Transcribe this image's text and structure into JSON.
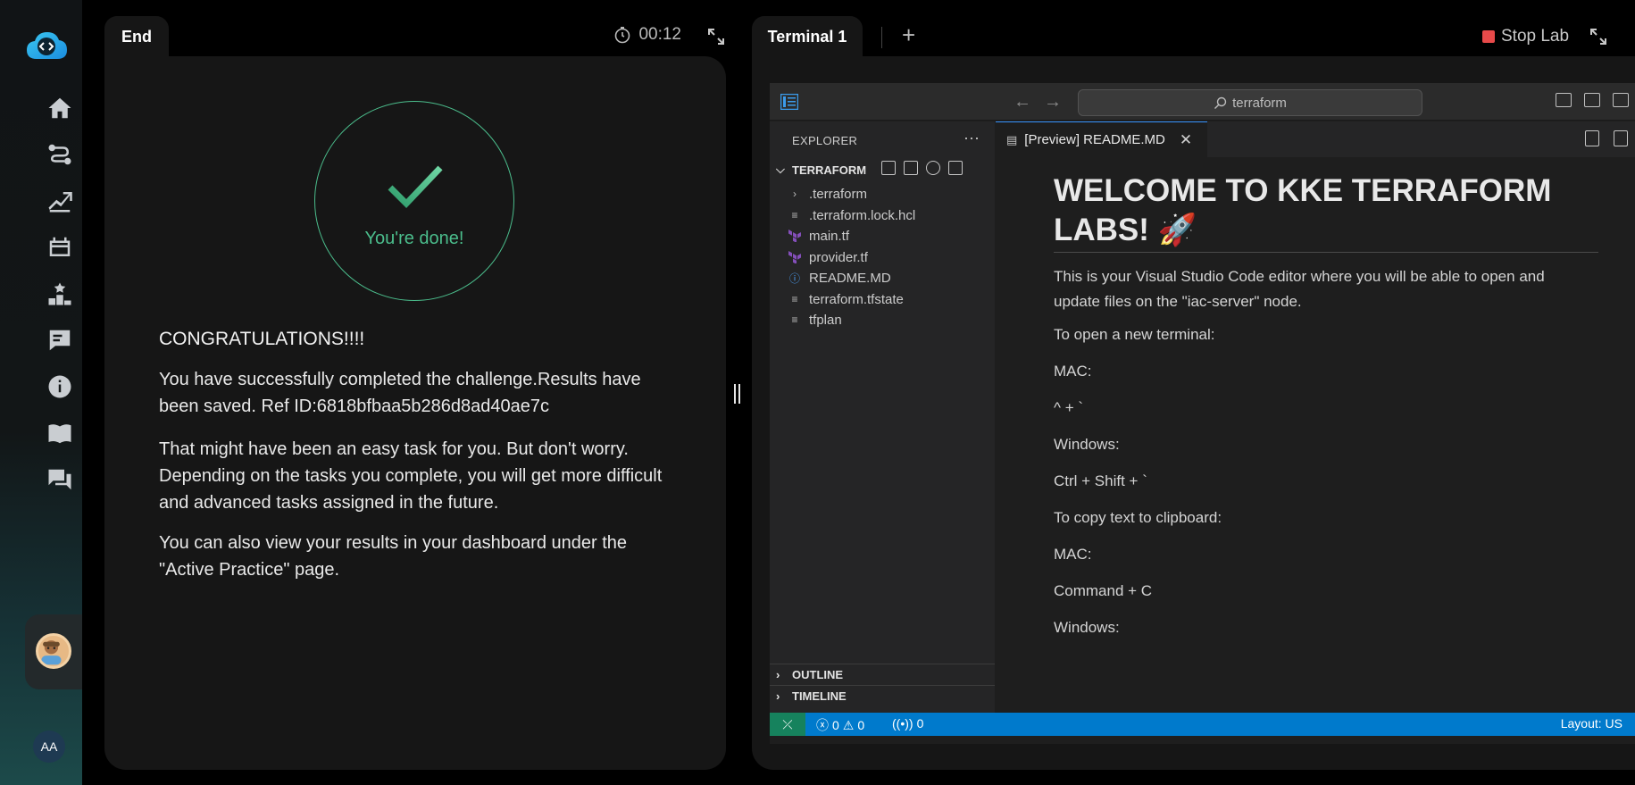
{
  "rail": {
    "nav_icons": [
      "home-icon",
      "roadmap-icon",
      "progress-icon",
      "labs-icon",
      "leaderboard-icon",
      "feedback-icon",
      "info-icon",
      "book-icon",
      "chat-icon"
    ],
    "initials": "AA"
  },
  "end_panel": {
    "tab_label": "End",
    "timer": "00:12",
    "done_text": "You're done!",
    "heading": "CONGRATULATIONS!!!!",
    "para1": "You have successfully completed the challenge.Results have been saved. Ref ID:6818bfbaa5b286d8ad40ae7c",
    "para2": "That might have been an easy task for you. But don't worry. Depending on the tasks you complete, you will get more difficult and advanced tasks assigned in the future.",
    "para3": "You can also view your results in your dashboard under the \"Active Practice\" page."
  },
  "terminal_panel": {
    "tab_label": "Terminal 1",
    "add_label": "+",
    "stop_label": "Stop Lab"
  },
  "vscode": {
    "search_placeholder": "terraform",
    "explorer_title": "EXPLORER",
    "folder": "TERRAFORM",
    "files": [
      ".terraform",
      ".terraform.lock.hcl",
      "main.tf",
      "provider.tf",
      "README.MD",
      "terraform.tfstate",
      "tfplan"
    ],
    "outline": "OUTLINE",
    "timeline": "TIMELINE",
    "tab": "[Preview] README.MD",
    "preview": {
      "h1": "WELCOME TO KKE TERRAFORM LABS! 🚀",
      "lines": [
        "This is your Visual Studio Code editor where you will be able to open and update files on the \"iac-server\" node.",
        "To open a new terminal:",
        "MAC:",
        "^ + `",
        "Windows:",
        "Ctrl + Shift + `",
        "To copy text to clipboard:",
        "MAC:",
        "Command + C",
        "Windows:"
      ]
    },
    "status": {
      "errors": "0",
      "warnings": "0",
      "ports": "0",
      "layout": "Layout: US"
    }
  }
}
